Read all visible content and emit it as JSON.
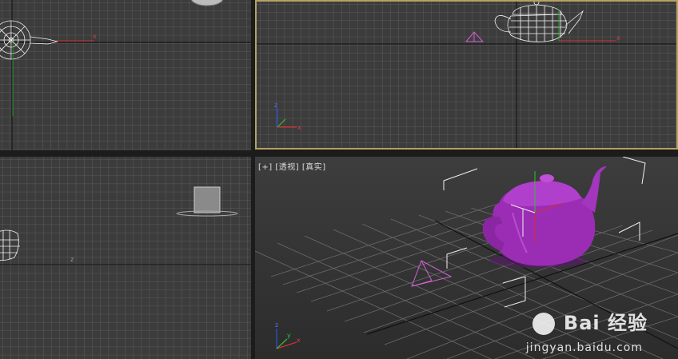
{
  "viewports": {
    "top": {
      "name": "top-viewport"
    },
    "front": {
      "name": "front-viewport"
    },
    "left": {
      "name": "left-viewport"
    },
    "perspective": {
      "label_plus": "[+]",
      "label_view": "[透视]",
      "label_shading": "[真实]"
    }
  },
  "axis_labels": {
    "x": "x",
    "y": "y",
    "z": "z"
  },
  "colors": {
    "teapot": "#9b2db5",
    "viewport_bg": "#3c3c3c",
    "grid": "#555555",
    "active_border": "#b5a163",
    "axis_x": "#d03030",
    "axis_y": "#30c030",
    "axis_z": "#3050e0",
    "camera": "#d060d0"
  },
  "watermark": {
    "brand": "Bai  经验",
    "url": "jingyan.baidu.com"
  }
}
